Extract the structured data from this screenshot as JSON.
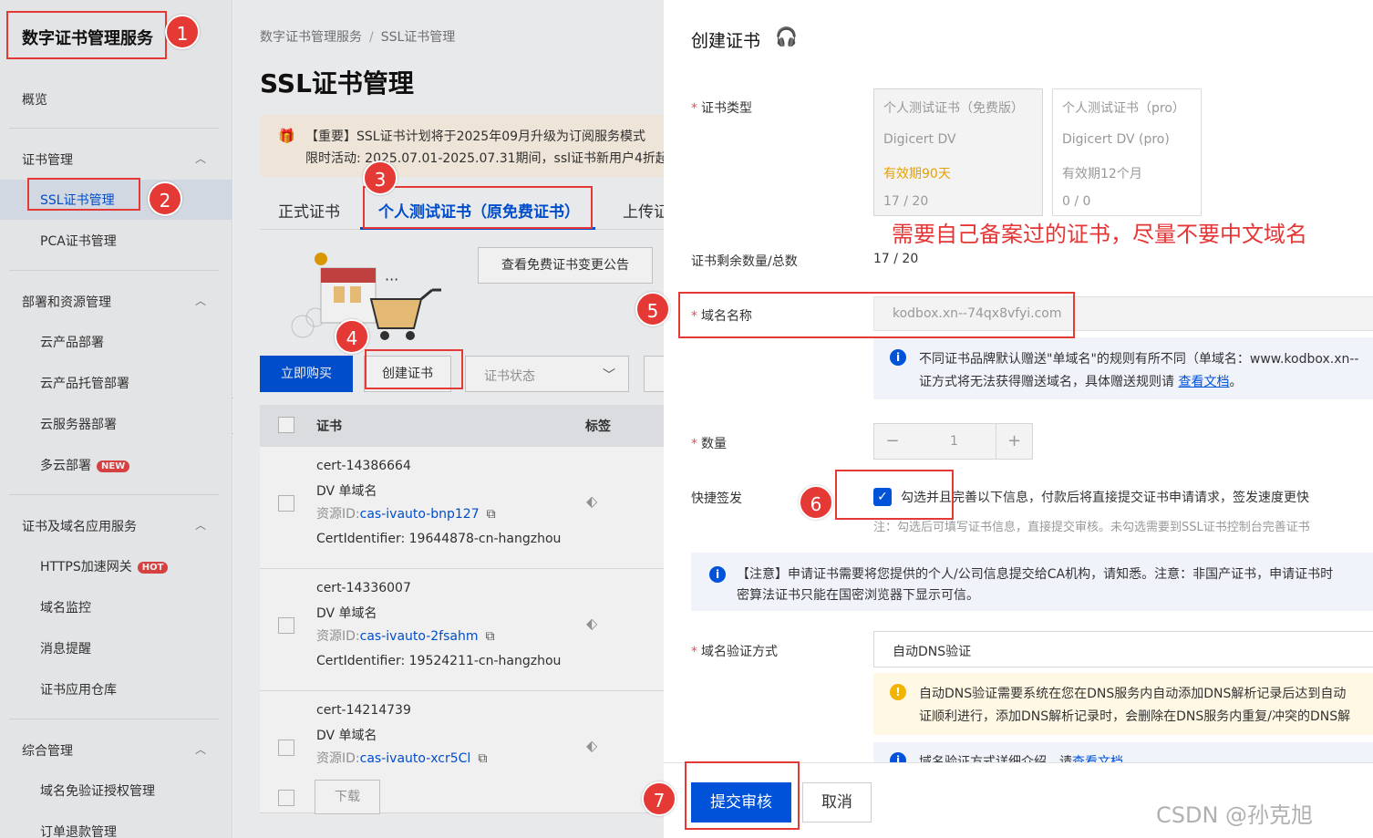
{
  "sidebar": {
    "title": "数字证书管理服务",
    "overview": "概览",
    "groups": [
      {
        "label": "证书管理",
        "items": [
          "SSL证书管理",
          "PCA证书管理"
        ]
      },
      {
        "label": "部署和资源管理",
        "items": [
          "云产品部署",
          "云产品托管部署",
          "云服务器部署",
          "多云部署"
        ]
      },
      {
        "label": "证书及域名应用服务",
        "items": [
          "HTTPS加速网关",
          "域名监控",
          "消息提醒",
          "证书应用仓库"
        ]
      },
      {
        "label": "综合管理",
        "items": [
          "域名免验证授权管理",
          "订单退款管理"
        ]
      }
    ],
    "badge_new": "NEW",
    "badge_hot": "HOT"
  },
  "main": {
    "breadcrumb": [
      "数字证书管理服务",
      "SSL证书管理"
    ],
    "title": "SSL证书管理",
    "notice_line1": "【重要】SSL证书计划将于2025年09月升级为订阅服务模式",
    "notice_line2": "限时活动: 2025.07.01-2025.07.31期间，ssl证书新用户4折起",
    "tabs": [
      "正式证书",
      "个人测试证书（原免费证书）",
      "上传证"
    ],
    "notice_button": "查看免费证书变更公告",
    "buy_button": "立即购买",
    "create_button": "创建证书",
    "status_placeholder": "证书状态",
    "table_headers": [
      "证书",
      "标签"
    ],
    "rows": [
      {
        "name": "cert-14386664",
        "type": "DV 单域名",
        "rid_label": "资源ID:",
        "rid": "cas-ivauto-bnp127",
        "cid": "CertIdentifier: 19644878-cn-hangzhou"
      },
      {
        "name": "cert-14336007",
        "type": "DV 单域名",
        "rid_label": "资源ID:",
        "rid": "cas-ivauto-2fsahm",
        "cid": "CertIdentifier: 19524211-cn-hangzhou"
      },
      {
        "name": "cert-14214739",
        "type": "DV 单域名",
        "rid_label": "资源ID:",
        "rid": "cas-ivauto-xcr5Cl",
        "cid": ""
      }
    ],
    "download_button": "下载"
  },
  "drawer": {
    "title": "创建证书",
    "cert_type_label": "证书类型",
    "cards": [
      {
        "name": "个人测试证书（免费版）",
        "brand": "Digicert DV",
        "validity": "有效期90天",
        "count": "17 / 20",
        "selected": true
      },
      {
        "name": "个人测试证书（pro）",
        "brand": "Digicert DV (pro)",
        "validity": "有效期12个月",
        "count": "0 / 0",
        "selected": false
      }
    ],
    "red_note": "需要自己备案过的证书，尽量不要中文域名",
    "remain_label": "证书剩余数量/总数",
    "remain_value": "17 / 20",
    "domain_label": "域名名称",
    "domain_value": "kodbox.xn--74qx8vfyi.com",
    "domain_info_line1": "不同证书品牌默认赠送\"单域名\"的规则有所不同（单域名：www.kodbox.xn--",
    "domain_info_line2": "证方式将无法获得赠送域名，具体赠送规则请 ",
    "domain_info_link": "查看文档",
    "domain_info_end": "。",
    "quantity_label": "数量",
    "quantity_value": "1",
    "quick_label": "快捷签发",
    "quick_text": "勾选并且完善以下信息，付款后将直接提交证书申请请求，签发速度更快",
    "quick_note": "注：勾选后可填写证书信息，直接提交审核。未勾选需要到SSL证书控制台完善证书",
    "notice_line1": "【注意】申请证书需要将您提供的个人/公司信息提交给CA机构，请知悉。注意：非国产证书，申请证书时",
    "notice_line2": "密算法证书只能在国密浏览器下显示可信。",
    "method_label": "域名验证方式",
    "method_value": "自动DNS验证",
    "warn_line1": "自动DNS验证需要系统在您在DNS服务内自动添加DNS解析记录后达到自动",
    "warn_line2": "证顺利进行，添加DNS解析记录时，会删除在DNS服务内重复/冲突的DNS解",
    "info3_text": "域名验证方式详细介绍，请",
    "info3_link": "查看文档",
    "submit_button": "提交审核",
    "cancel_button": "取消"
  },
  "annotations": [
    "1",
    "2",
    "3",
    "4",
    "5",
    "6",
    "7"
  ],
  "watermark": "CSDN @孙克旭"
}
